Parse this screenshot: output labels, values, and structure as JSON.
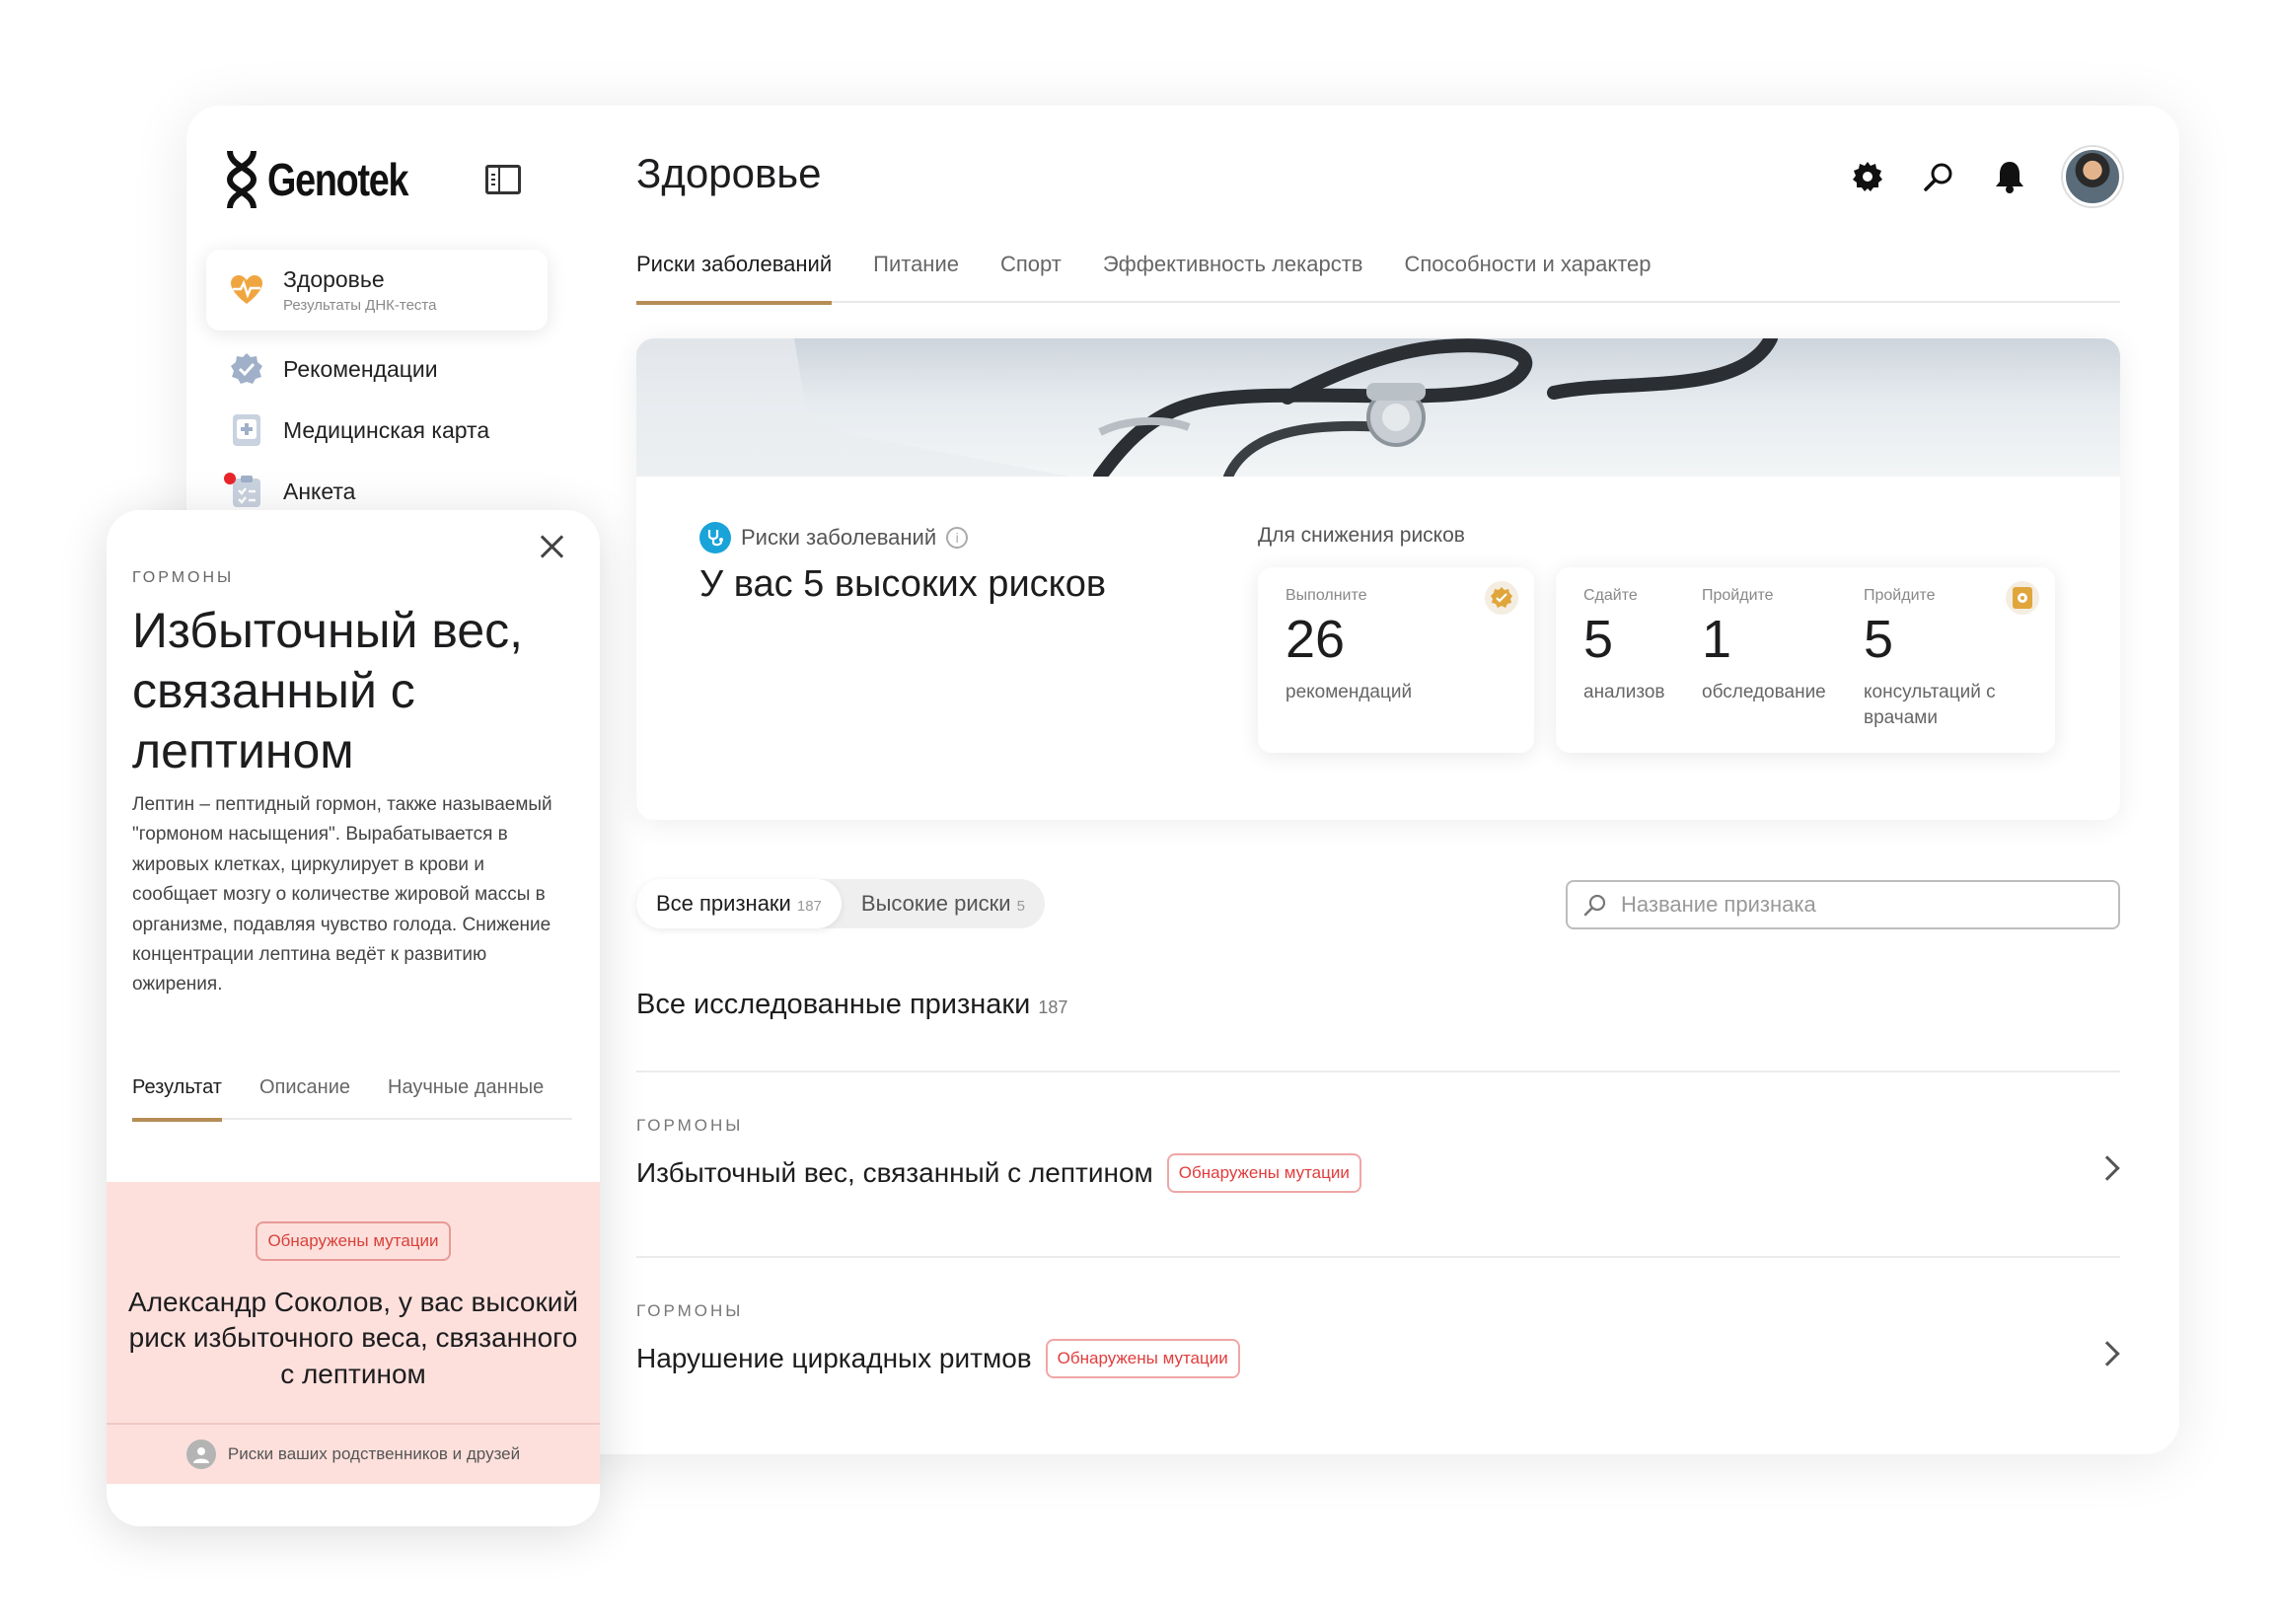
{
  "brand": {
    "name": "Genotek"
  },
  "sidebar": {
    "items": [
      {
        "label": "Здоровье",
        "sub": "Результаты ДНК-теста",
        "icon": "heart-pulse-icon"
      },
      {
        "label": "Рекомендации",
        "icon": "verified-badge-icon"
      },
      {
        "label": "Медицинская карта",
        "icon": "medical-card-icon"
      },
      {
        "label": "Анкета",
        "icon": "questionnaire-icon"
      }
    ]
  },
  "header": {
    "title": "Здоровье",
    "icons": [
      "gear-icon",
      "search-icon",
      "bell-icon",
      "avatar"
    ]
  },
  "tabs": [
    "Риски заболеваний",
    "Питание",
    "Спорт",
    "Эффективность лекарств",
    "Способности и характер"
  ],
  "hero": {
    "label": "Риски заболеваний",
    "title": "У вас 5 высоких рисков",
    "reduce_label": "Для снижения рисков",
    "stats": [
      {
        "caption": "Выполните",
        "value": "26",
        "sub": "рекомендаций"
      },
      {
        "caption": "Сдайте",
        "value": "5",
        "sub": "анализов"
      },
      {
        "caption": "Пройдите",
        "value": "1",
        "sub": "обследование"
      },
      {
        "caption": "Пройдите",
        "value": "5",
        "sub": "консультаций с врачами"
      }
    ],
    "colors": {
      "accent": "#b58d55",
      "risk_icon": "#1aa3d9"
    }
  },
  "filters": {
    "pills": [
      {
        "label": "Все признаки",
        "count": "187"
      },
      {
        "label": "Высокие риски",
        "count": "5"
      }
    ],
    "search_placeholder": "Название признака"
  },
  "section": {
    "title": "Все исследованные признаки",
    "count": "187"
  },
  "rows": [
    {
      "category": "ГОРМОНЫ",
      "title": "Избыточный вес, связанный с лептином",
      "tag": "Обнаружены мутации"
    },
    {
      "category": "ГОРМОНЫ",
      "title": "Нарушение циркадных ритмов",
      "tag": "Обнаружены мутации"
    }
  ],
  "panel": {
    "category": "ГОРМОНЫ",
    "title": "Избыточный вес, связанный с лептином",
    "description": "Лептин – пептидный гормон, также называемый \"гормоном насыщения\". Вырабатывается в жировых клетках, циркулирует в крови и сообщает мозгу о количестве жировой массы в организме, подавляя чувство голода. Снижение концентрации лептина ведёт к развитию ожирения.",
    "tabs": [
      "Результат",
      "Описание",
      "Научные данные"
    ],
    "result_tag": "Обнаружены мутации",
    "result_text": "Александр Соколов, у вас высокий риск избыточного веса, связанного с лептином",
    "footer": "Риски ваших родственников и друзей",
    "colors": {
      "result_bg": "#fde0dc",
      "tag_red": "#d9413b"
    }
  }
}
